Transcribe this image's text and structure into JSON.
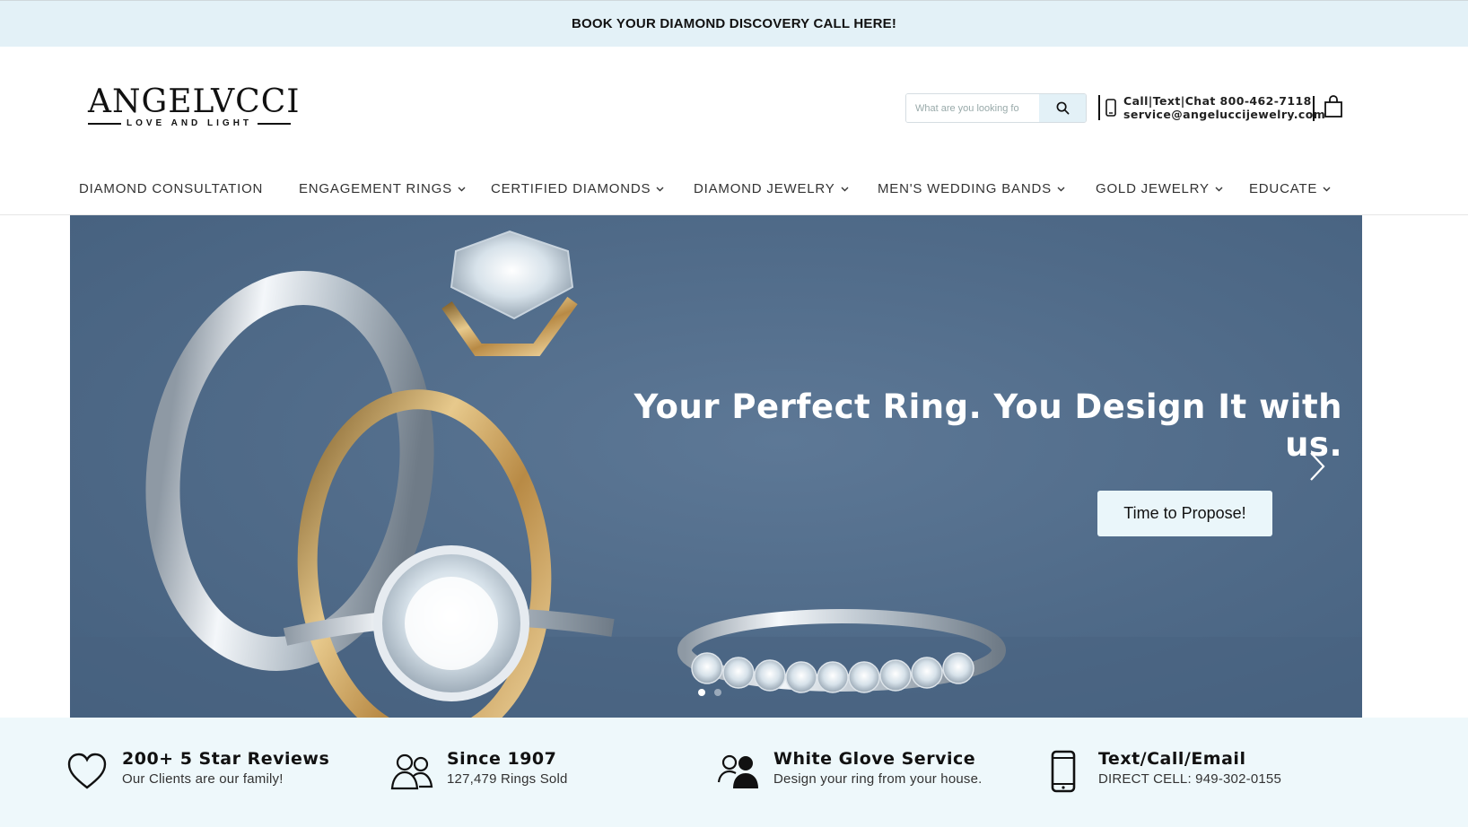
{
  "announcement": {
    "text": "BOOK YOUR DIAMOND DISCOVERY CALL HERE!"
  },
  "header": {
    "logo": {
      "wordmark": "ANGELVCCI",
      "tagline": "LOVE AND LIGHT"
    },
    "search": {
      "placeholder": "What are you looking fo",
      "icon": "search-icon"
    },
    "contact": {
      "line1": "Call|Text|Chat 800-462-7118",
      "line2": "service@angeluccijewelry.com",
      "icon": "phone-icon"
    },
    "cart_icon": "shopping-bag-icon"
  },
  "nav": {
    "items": [
      {
        "label": "DIAMOND CONSULTATION",
        "has_dropdown": false
      },
      {
        "label": "ENGAGEMENT RINGS",
        "has_dropdown": true
      },
      {
        "label": "CERTIFIED DIAMONDS",
        "has_dropdown": true
      },
      {
        "label": "DIAMOND JEWELRY",
        "has_dropdown": true
      },
      {
        "label": "MEN'S WEDDING BANDS",
        "has_dropdown": true
      },
      {
        "label": "GOLD JEWELRY",
        "has_dropdown": true
      },
      {
        "label": "EDUCATE",
        "has_dropdown": true
      }
    ]
  },
  "hero": {
    "headline": "Your Perfect Ring. You Design It with us.",
    "cta_label": "Time to Propose!",
    "next_icon": "chevron-right-icon",
    "slide_count": 2,
    "active_slide": 1
  },
  "features": [
    {
      "icon": "heart-icon",
      "title": "200+ 5 Star Reviews",
      "subtitle": "Our Clients are our family!"
    },
    {
      "icon": "users-icon",
      "title": "Since 1907",
      "subtitle": "127,479 Rings Sold"
    },
    {
      "icon": "user-group-icon",
      "title": "White Glove Service",
      "subtitle": "Design your ring from your house."
    },
    {
      "icon": "mobile-phone-icon",
      "title": "Text/Call/Email",
      "subtitle": "DIRECT CELL: 949-302-0155"
    }
  ],
  "colors": {
    "announcement_bg": "#e3f1f7",
    "hero_bg": "#4f6a88",
    "features_bg": "#eef8fb",
    "cta_bg": "#eaf6fa"
  }
}
